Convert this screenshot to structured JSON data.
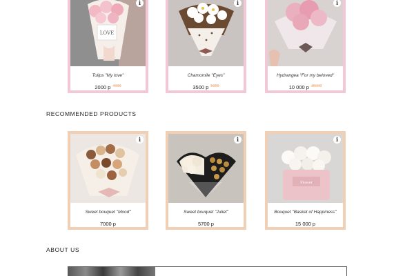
{
  "top_products": [
    {
      "name": "Tulips \"My love\"",
      "price": "2000 р",
      "old_price": "4000",
      "icon": "info-icon"
    },
    {
      "name": "Chamomile \"Eyes\"",
      "price": "3500 р",
      "old_price": "5000",
      "icon": "info-icon"
    },
    {
      "name": "Hydrangea \"For my beloved\"",
      "price": "10 000 р",
      "old_price": "15000",
      "icon": "info-icon"
    }
  ],
  "recommended": {
    "heading": "RECOMMENDED PRODUCTS",
    "products": [
      {
        "name": "Sweet bouquet \"Mood\"",
        "price": "7000 р",
        "icon": "info-icon"
      },
      {
        "name": "Sweet bouquet \"Juliet\"",
        "price": "5700 р",
        "icon": "info-icon"
      },
      {
        "name": "Bouquet \"Basket of Happiness\"",
        "price": "15 000 р",
        "icon": "info-icon"
      }
    ]
  },
  "about": {
    "heading": "ABOUT US"
  },
  "colors": {
    "pink_border": "#f2c7d6",
    "peach_border": "#f0cfb5",
    "old_price": "#f0b287"
  }
}
